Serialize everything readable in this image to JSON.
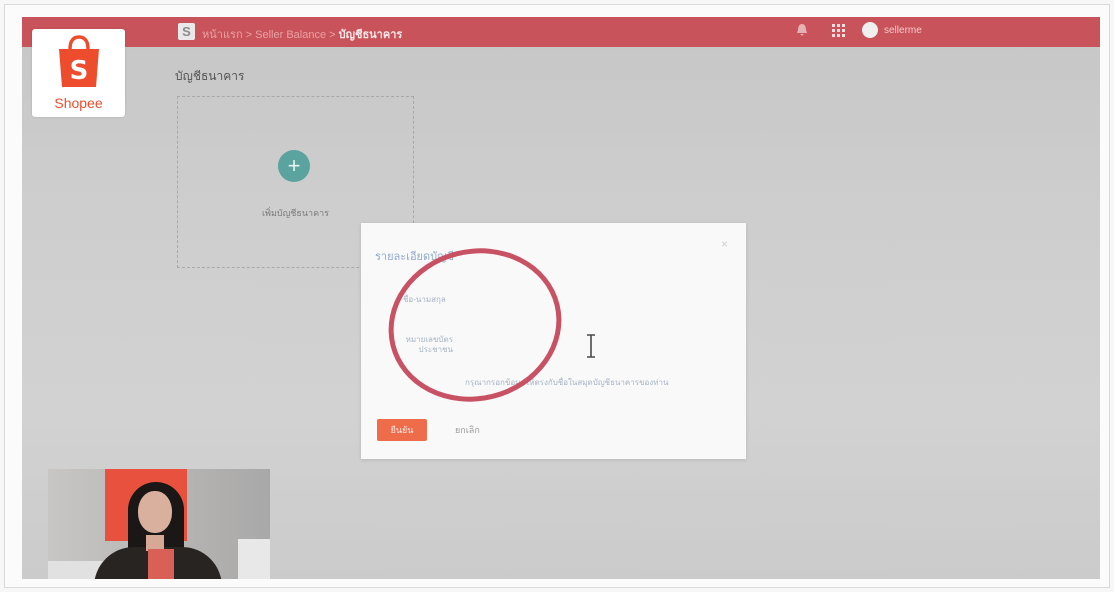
{
  "topbar": {
    "breadcrumb_parent": "หน้าแรก > Seller Balance >",
    "breadcrumb_current": "บัญชีธนาคาร",
    "username": "sellerme"
  },
  "logo": {
    "text": "Shopee"
  },
  "page": {
    "title": "บัญชีธนาคาร",
    "add_label": "เพิ่มบัญชีธนาคาร",
    "add_symbol": "+"
  },
  "modal": {
    "title": "รายละเอียดบัญชี",
    "close_symbol": "×",
    "field_1_label": "ชื่อ-นามสกุล",
    "field_2_label": "หมายเลขบัตรประชาชน",
    "note": "กรุณากรอกข้อมูลให้ตรงกับชื่อในสมุดบัญชีธนาคารของท่าน",
    "confirm_label": "ยืนยัน",
    "cancel_label": "ยกเลิก"
  },
  "colors": {
    "brand": "#ee4d2d",
    "topbar": "#c9535a",
    "add_button": "#5aa39e",
    "annotation": "#c85264"
  }
}
